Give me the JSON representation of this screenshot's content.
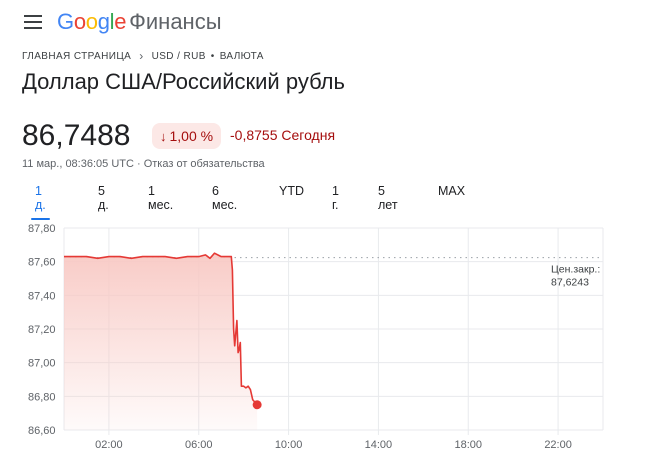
{
  "header": {
    "brand_letters": [
      {
        "ch": "G",
        "color": "#4285f4"
      },
      {
        "ch": "o",
        "color": "#ea4335"
      },
      {
        "ch": "o",
        "color": "#fbbc05"
      },
      {
        "ch": "g",
        "color": "#4285f4"
      },
      {
        "ch": "l",
        "color": "#34a853"
      },
      {
        "ch": "e",
        "color": "#ea4335"
      }
    ],
    "brand_suffix": "Финансы",
    "menu_icon": "hamburger-menu-icon"
  },
  "breadcrumb": {
    "home": "ГЛАВНАЯ СТРАНИЦА",
    "pair": "USD / RUB",
    "separator_dot": "•",
    "category": "ВАЛЮТА"
  },
  "title": "Доллар США/Российский рубль",
  "quote": {
    "price": "86,7488",
    "change_percent": "1,00 %",
    "change_arrow": "↓",
    "change_text": "-0,8755 Сегодня",
    "timestamp": "11 мар., 08:36:05 UTC · Отказ от обязательства"
  },
  "tabs": [
    {
      "label": "1 д.",
      "active": true
    },
    {
      "label": "5 д.",
      "active": false
    },
    {
      "label": "1 мес.",
      "active": false
    },
    {
      "label": "6 мес.",
      "active": false
    },
    {
      "label": "YTD",
      "active": false
    },
    {
      "label": "1 г.",
      "active": false
    },
    {
      "label": "5 лет",
      "active": false
    },
    {
      "label": "MAX",
      "active": false
    }
  ],
  "colors": {
    "line": "#e53935",
    "fill": "#f8c9c4",
    "negative_text": "#a50e0e",
    "negative_bg": "#fce8e6",
    "accent": "#1a73e8",
    "grid": "#e8eaed",
    "axis_text": "#5f6368"
  },
  "chart_data": {
    "type": "area",
    "x_unit": "hours (UTC)",
    "xlim": [
      0,
      24
    ],
    "ylim": [
      86.6,
      87.8
    ],
    "y_ticks": [
      87.8,
      87.6,
      87.4,
      87.2,
      87.0,
      86.8,
      86.6
    ],
    "y_tick_labels": [
      "87,80",
      "87,60",
      "87,40",
      "87,20",
      "87,00",
      "86,80",
      "86,60"
    ],
    "x_ticks": [
      2,
      6,
      10,
      14,
      18,
      22
    ],
    "x_tick_labels": [
      "02:00",
      "06:00",
      "10:00",
      "14:00",
      "18:00",
      "22:00"
    ],
    "previous_close": {
      "label": "Цен.закр.:",
      "value": "87,6243",
      "y": 87.6243
    },
    "series": [
      {
        "x": [
          0,
          0.5,
          1,
          1.5,
          2,
          2.5,
          3,
          3.5,
          4,
          4.5,
          5,
          5.5,
          6,
          6.3,
          6.5,
          6.7,
          7,
          7.3,
          7.45,
          7.5,
          7.55,
          7.6,
          7.7,
          7.75,
          7.8,
          7.85,
          7.9,
          8.0,
          8.1,
          8.2,
          8.3,
          8.4,
          8.6
        ],
        "y": [
          87.63,
          87.63,
          87.63,
          87.62,
          87.63,
          87.63,
          87.62,
          87.63,
          87.63,
          87.63,
          87.62,
          87.63,
          87.63,
          87.64,
          87.62,
          87.65,
          87.63,
          87.63,
          87.63,
          87.55,
          87.2,
          87.1,
          87.25,
          87.06,
          87.08,
          87.12,
          86.86,
          86.86,
          86.85,
          86.86,
          86.84,
          86.78,
          86.75
        ]
      }
    ],
    "current_point": {
      "x": 8.6,
      "y": 86.75
    }
  }
}
